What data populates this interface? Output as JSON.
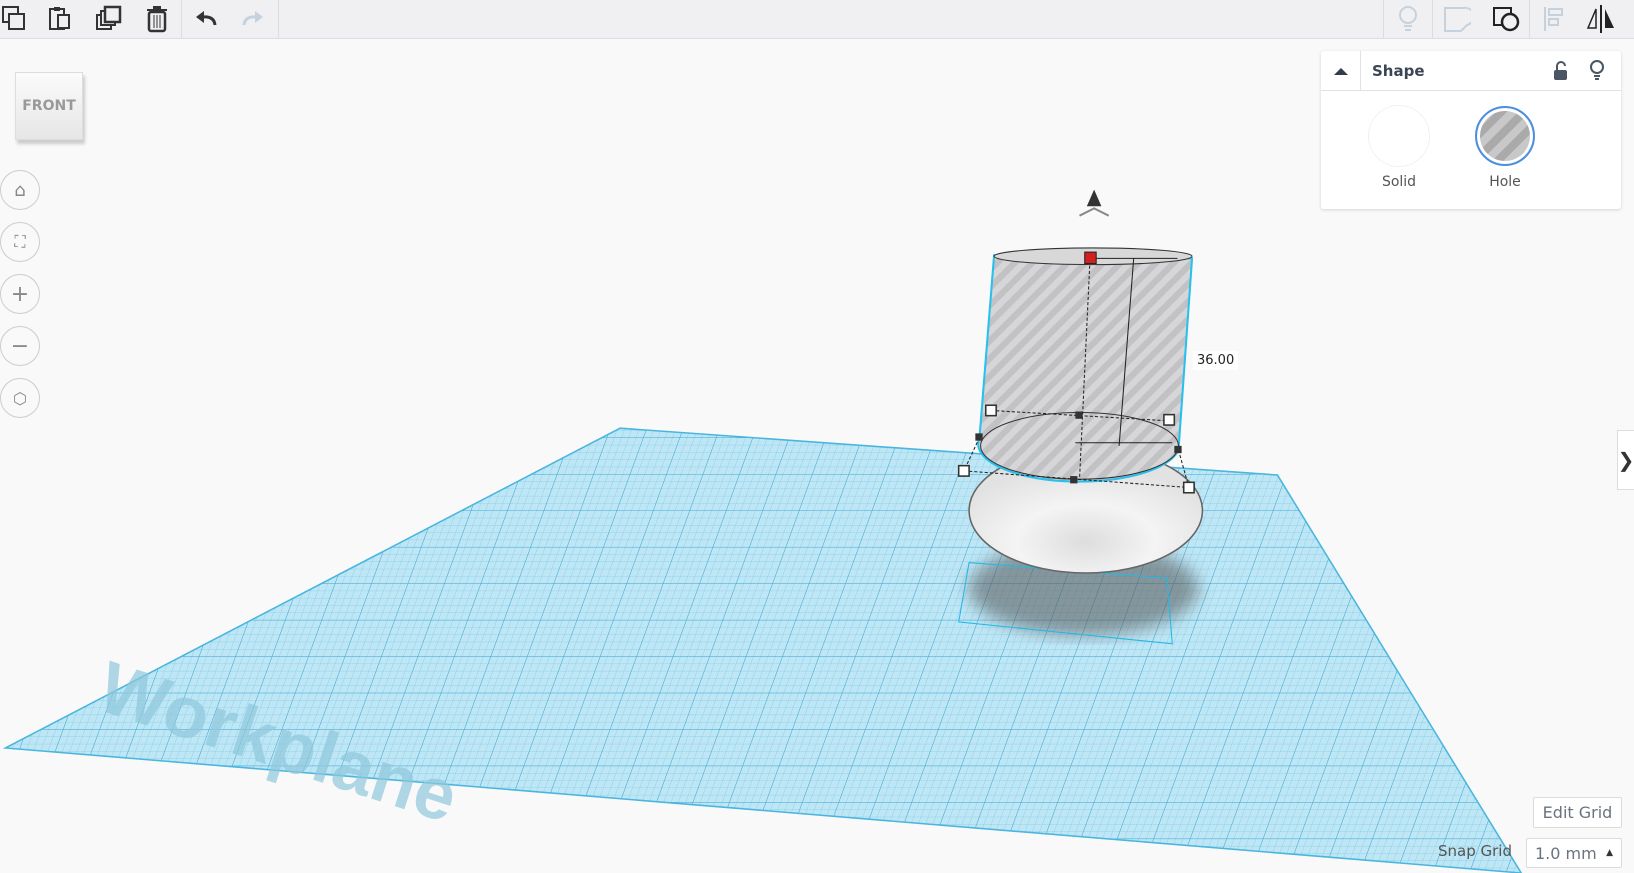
{
  "toolbar": {
    "left": [
      "copy-icon",
      "paste-icon",
      "duplicate-icon",
      "delete-icon",
      "undo-icon",
      "redo-icon"
    ],
    "right": [
      "lightbulb-icon",
      "note-icon",
      "shape-union-icon",
      "align-icon",
      "mirror-icon"
    ]
  },
  "viewcube": {
    "face": "FRONT"
  },
  "nav": [
    "home-icon",
    "fit-icon",
    "zoom-in-icon",
    "zoom-out-icon",
    "perspective-icon"
  ],
  "shape_panel": {
    "title": "Shape",
    "options": [
      {
        "label": "Solid"
      },
      {
        "label": "Hole",
        "selected": true
      }
    ],
    "accent": "#4a90e2"
  },
  "dimension": {
    "height": "36.00"
  },
  "workplane": {
    "label": "Workplane",
    "color": "#7fd0ec"
  },
  "grid": {
    "edit_label": "Edit Grid",
    "snap_label": "Snap Grid",
    "snap_value": "1.0 mm"
  }
}
